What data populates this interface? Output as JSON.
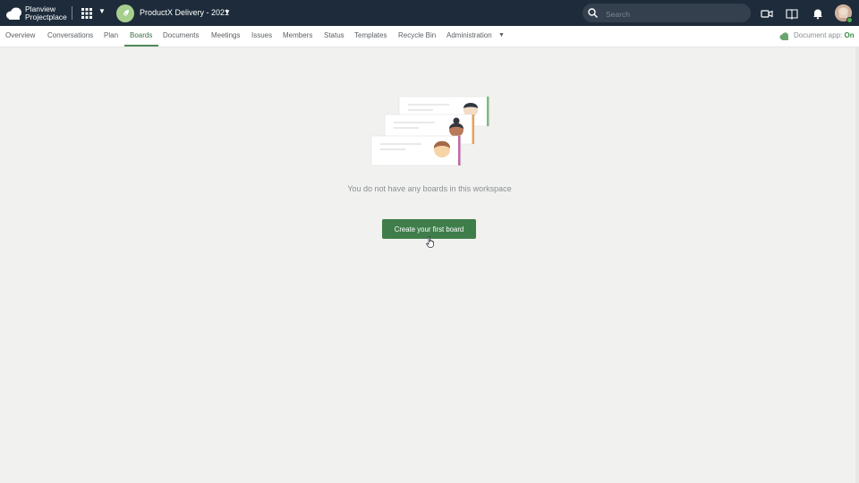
{
  "topbar": {
    "logo_line1": "Planview",
    "logo_line2": "Projectplace",
    "workspace_name": "ProductX Delivery - 2021",
    "search_placeholder": "Search"
  },
  "tabs": [
    {
      "label": "Overview"
    },
    {
      "label": "Conversations"
    },
    {
      "label": "Plan"
    },
    {
      "label": "Boards"
    },
    {
      "label": "Documents"
    },
    {
      "label": "Meetings"
    },
    {
      "label": "Issues"
    },
    {
      "label": "Members"
    },
    {
      "label": "Status"
    },
    {
      "label": "Templates"
    },
    {
      "label": "Recycle Bin"
    },
    {
      "label": "Administration"
    }
  ],
  "active_tab": "Boards",
  "doc_app": {
    "label": "Document app:",
    "state": "On"
  },
  "empty_state": {
    "message": "You do not have any boards in this workspace",
    "button_label": "Create your first board"
  },
  "colors": {
    "topbar": "#1d2b3a",
    "accent_green": "#3f7e4a",
    "background": "#f1f1ef"
  }
}
